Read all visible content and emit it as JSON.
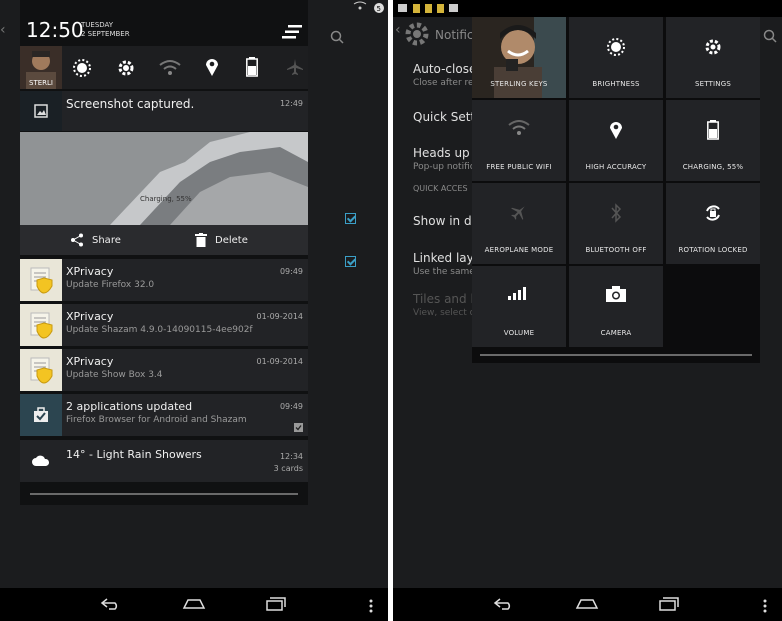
{
  "left_panel": {
    "header": {
      "time": "12:50",
      "day": "TUESDAY",
      "date": "2 SEPTEMBER"
    },
    "quick_user_label": "STERLI",
    "background_rows": [
      {
        "title": "",
        "sub": ""
      }
    ],
    "screenshot_notif": {
      "title": "Screenshot captured.",
      "time": "12:49",
      "preview_caption": "Charging, 55%",
      "share_label": "Share",
      "delete_label": "Delete"
    },
    "notifications": [
      {
        "title": "XPrivacy",
        "sub": "Update Firefox 32.0",
        "time": "09:49"
      },
      {
        "title": "XPrivacy",
        "sub": "Update Shazam 4.9.0-14090115-4ee902f",
        "time": "01-09-2014"
      },
      {
        "title": "XPrivacy",
        "sub": "Update Show Box 3.4",
        "time": "01-09-2014"
      },
      {
        "title": "2 applications updated",
        "sub": "Firefox Browser for Android and Shazam",
        "time": "09:49"
      },
      {
        "title": "14° - Light Rain Showers",
        "sub": "3 cards",
        "time": "12:34"
      }
    ]
  },
  "right_panel": {
    "bg_title": "Notificati",
    "bg_rows": [
      {
        "title": "Auto-close",
        "sub": "Close after re"
      },
      {
        "title": "Quick Setti",
        "sub": ""
      },
      {
        "title": "Heads up",
        "sub": "Pop-up notific"
      },
      {
        "title": "QUICK ACCES",
        "sub": ""
      },
      {
        "title": "Show in dra",
        "sub": ""
      },
      {
        "title": "Linked layo",
        "sub": "Use the same"
      },
      {
        "title": "Tiles and la",
        "sub": "View, select o"
      }
    ],
    "tiles": [
      {
        "label": "STERLING KEYS",
        "icon": "user-photo"
      },
      {
        "label": "BRIGHTNESS",
        "icon": "brightness-icon"
      },
      {
        "label": "SETTINGS",
        "icon": "gear-icon"
      },
      {
        "label": "FREE PUBLIC WIFI",
        "icon": "wifi-icon"
      },
      {
        "label": "HIGH ACCURACY",
        "icon": "location-icon"
      },
      {
        "label": "CHARGING, 55%",
        "icon": "battery-icon"
      },
      {
        "label": "AEROPLANE MODE",
        "icon": "airplane-icon"
      },
      {
        "label": "BLUETOOTH OFF",
        "icon": "bluetooth-icon"
      },
      {
        "label": "ROTATION LOCKED",
        "icon": "rotation-icon"
      },
      {
        "label": "VOLUME",
        "icon": "volume-icon"
      },
      {
        "label": "CAMERA",
        "icon": "camera-icon"
      }
    ]
  }
}
